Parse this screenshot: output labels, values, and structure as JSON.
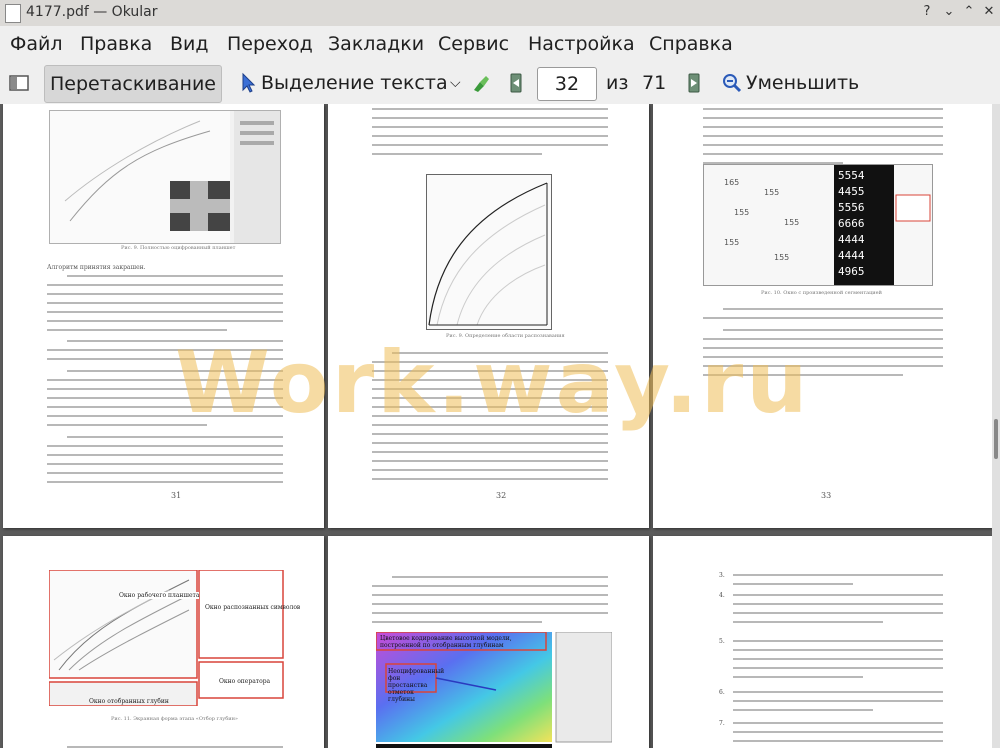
{
  "window": {
    "title": "4177.pdf — Okular"
  },
  "menu": {
    "items": [
      "Файл",
      "Правка",
      "Вид",
      "Переход",
      "Закладки",
      "Сервис",
      "Настройка",
      "Справка"
    ]
  },
  "toolbar": {
    "drag_label": "Перетаскивание",
    "select_label": "Выделение текста",
    "page_current": "32",
    "page_of": "из",
    "page_total": "71",
    "zoom_out_label": "Уменьшить"
  },
  "pages": {
    "p31": {
      "number": "31",
      "caption": "Рис. 9. Полностью оцифрованный планшет",
      "first_line": "Алгоритм принятия закрашен."
    },
    "p32": {
      "number": "32",
      "caption": "Рис. 9. Определение области распознавания"
    },
    "p33": {
      "number": "33",
      "caption": "Рис. 10. Окно с произведенной сегментацией"
    },
    "p34": {
      "caption": "Рис. 11. Экранная форма этапа «Отбор глубин»",
      "labels": [
        "Окно рабочего планшета",
        "Окно распознанных символов",
        "Окно оператора",
        "Окно отобранных глубин"
      ]
    },
    "p35": {
      "labels": [
        "Цветовое кодирование высотной модели, построенной по отобранным глубинам",
        "Неоцифрованный фон простанства отметок глубины"
      ]
    },
    "p36": {
      "numbers": [
        "3.",
        "4.",
        "5.",
        "6.",
        "7."
      ]
    }
  },
  "watermark": {
    "text": "Work.way.ru"
  },
  "colors": {
    "accent_red": "#d9443a",
    "window_bg": "#5c5c5c",
    "toolbar_bg": "#efefef"
  }
}
